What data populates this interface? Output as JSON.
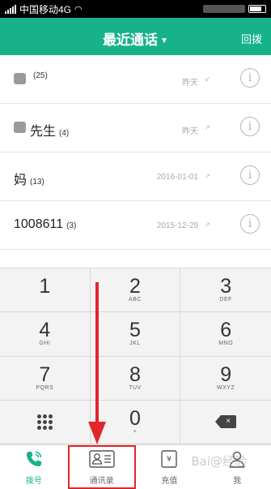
{
  "status_bar": {
    "carrier": "中国移动4G"
  },
  "header": {
    "title": "最近通话",
    "action": "回拨"
  },
  "calls": [
    {
      "name": "",
      "count": "(25)",
      "date": "昨天",
      "direction": "↙",
      "avatar_blurred": true
    },
    {
      "name": "先生",
      "count": "(4)",
      "date": "昨天",
      "direction": "↗",
      "avatar_blurred": true
    },
    {
      "name": "妈",
      "count": "(13)",
      "date": "2016-01-01",
      "direction": "↗",
      "avatar_blurred": false
    },
    {
      "name": "1008611",
      "count": "(3)",
      "date": "2015-12-29",
      "direction": "↗",
      "avatar_blurred": false
    }
  ],
  "keypad": {
    "keys": [
      {
        "digit": "1",
        "letters": ""
      },
      {
        "digit": "2",
        "letters": "ABC"
      },
      {
        "digit": "3",
        "letters": "DEF"
      },
      {
        "digit": "4",
        "letters": "GHI"
      },
      {
        "digit": "5",
        "letters": "JKL"
      },
      {
        "digit": "6",
        "letters": "MNO"
      },
      {
        "digit": "7",
        "letters": "PQRS"
      },
      {
        "digit": "8",
        "letters": "TUV"
      },
      {
        "digit": "9",
        "letters": "WXYZ"
      },
      {
        "digit": "0",
        "letters": "+"
      }
    ],
    "backspace_label": "×"
  },
  "tabs": [
    {
      "label": "拨号",
      "icon": "phone-icon",
      "active": true
    },
    {
      "label": "通讯录",
      "icon": "contact-card-icon",
      "active": false,
      "highlighted": true
    },
    {
      "label": "充值",
      "icon": "yen-recharge-icon",
      "active": false
    },
    {
      "label": "我",
      "icon": "person-icon",
      "active": false
    }
  ],
  "colors": {
    "brand": "#17b289",
    "annotation": "#e0262b"
  },
  "watermark": "Bai@经验"
}
